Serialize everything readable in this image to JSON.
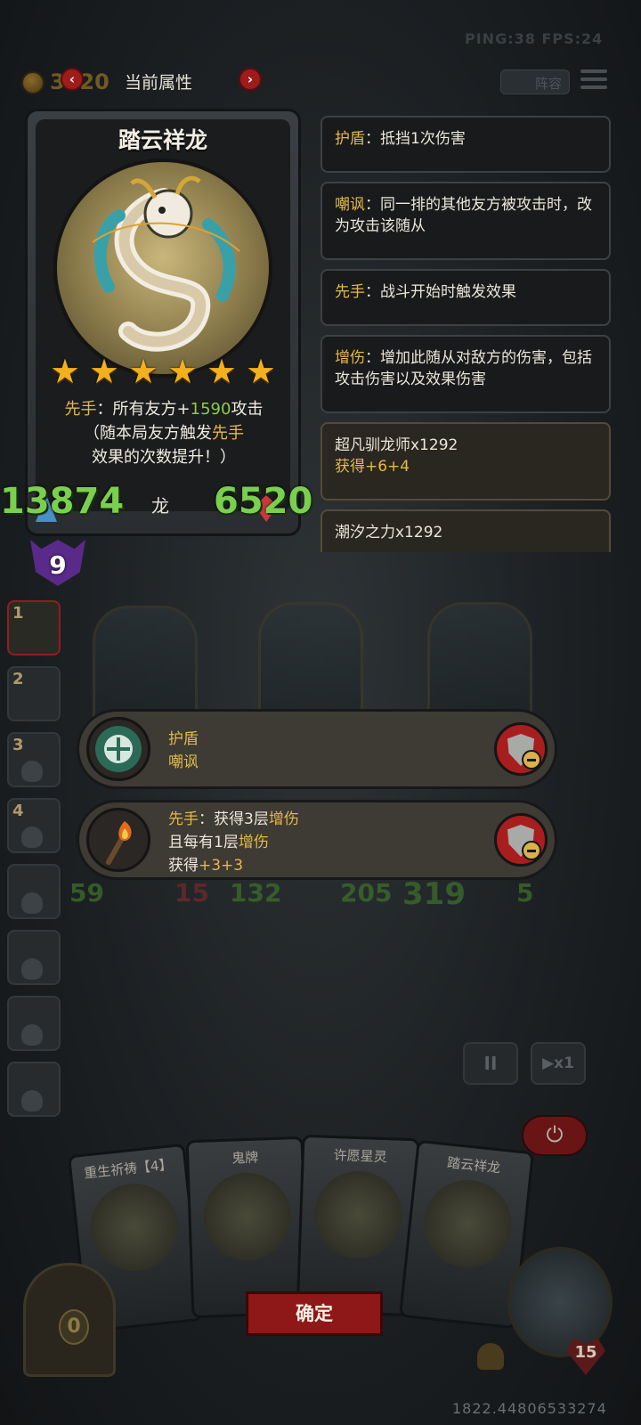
{
  "hud": {
    "ping_fps": "PING:38  FPS:24",
    "coins": "3520",
    "panel_title": "当前属性",
    "prev_arrow": "‹",
    "next_arrow": "›",
    "lineup_label": "阵容"
  },
  "card": {
    "name": "踏云祥龙",
    "stars": 6,
    "desc_keyword": "先手",
    "desc_part1": "：所有友方+",
    "desc_value": "1590",
    "desc_part2": "攻击",
    "desc_line2a": "（随本局友方触发",
    "desc_line2_keyword": "先手",
    "desc_line3": "效果的次数提升！）",
    "tribe": "龙",
    "attack": "13874",
    "health": "6520"
  },
  "keywords": [
    {
      "keyword": "护盾",
      "text": "：抵挡1次伤害"
    },
    {
      "keyword": "嘲讽",
      "text": "：同一排的其他友方被攻击时，改为攻击该随从"
    },
    {
      "keyword": "先手",
      "text": "：战斗开始时触发效果"
    },
    {
      "keyword": "增伤",
      "text": "：增加此随从对敌方的伤害，包括攻击伤害以及效果伤害"
    }
  ],
  "buffs": [
    {
      "source": "超凡驯龙师x1292",
      "gain": "获得+6+4"
    },
    {
      "source": "潮汐之力x1292",
      "gain": ""
    }
  ],
  "level": "9",
  "side_slots": [
    "1",
    "2",
    "3",
    "4",
    "",
    "",
    "",
    ""
  ],
  "board_stats": [
    "59",
    "15",
    "132",
    "205",
    "319",
    "5"
  ],
  "popups": [
    {
      "line1": "护盾",
      "line2": "嘲讽",
      "line3": ""
    },
    {
      "line1a": "先手",
      "line1b": "：获得3层",
      "line1c": "增伤",
      "line2a": "且每有1层",
      "line2b": "增伤",
      "line3a": "获得",
      "line3b": "+3+3"
    }
  ],
  "controls": {
    "pause": "II",
    "speed": "▶x1",
    "power": "⏻"
  },
  "hand": [
    {
      "title": "重生祈祷【4】"
    },
    {
      "title": "鬼牌"
    },
    {
      "title": "许愿星灵"
    },
    {
      "title": "踏云祥龙"
    }
  ],
  "confirm_label": "确定",
  "gold_slot": "0",
  "hero_hp": "15",
  "coordinate": "1822.44806533274",
  "icons": {
    "coin": "coin-icon",
    "menu": "menu-icon",
    "star": "★",
    "remove": "shield-minus-icon"
  }
}
